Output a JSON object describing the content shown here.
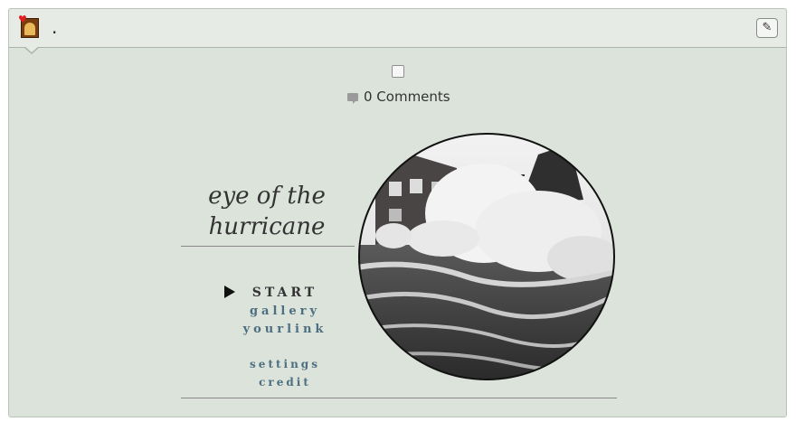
{
  "header": {
    "title": "."
  },
  "post": {
    "comments_label": "0 Comments"
  },
  "theme": {
    "title": "eye of the hurricane",
    "menu": {
      "start": "START",
      "gallery": "gallery",
      "yourlink": "yourlink",
      "settings": "settings",
      "credit": "credit"
    }
  },
  "icons": {
    "avatar": "user-avatar-icon",
    "edit": "pencil-icon",
    "comment": "comment-bubble-icon",
    "menu_pointer": "play-arrow-icon"
  }
}
